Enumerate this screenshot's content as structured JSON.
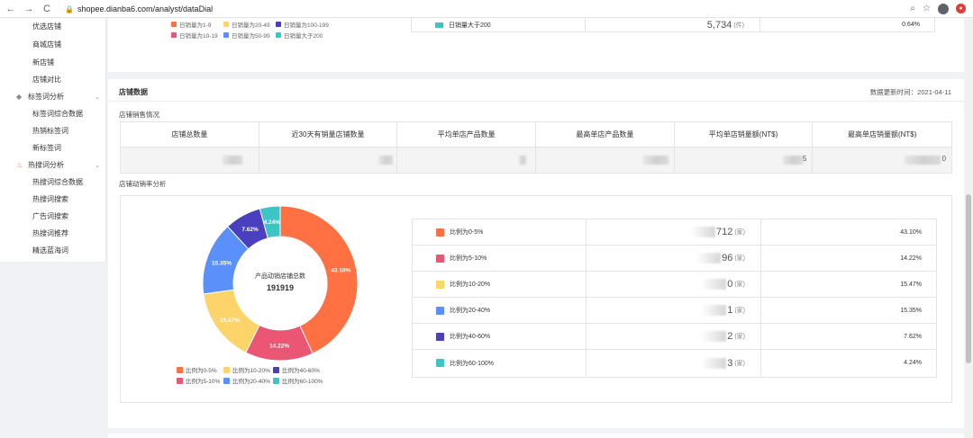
{
  "browser": {
    "url": "shopee.dianba6.com/analyst/dataDial",
    "back_icon": "←",
    "forward_icon": "→",
    "reload_icon": "C"
  },
  "sidebar": {
    "items_top": [
      "优选店铺",
      "商城店铺",
      "新店铺",
      "店铺对比"
    ],
    "group1": "标签词分析",
    "group1_items": [
      "标签词综合数据",
      "热销标签词",
      "新标签词"
    ],
    "group2": "热搜词分析",
    "group2_items": [
      "热搜词综合数据",
      "热搜词搜索",
      "广告词搜索",
      "热搜词推荐",
      "精选蓝海词"
    ]
  },
  "top_card": {
    "legend": [
      {
        "label": "日销量为1-9",
        "color": "#ff7043"
      },
      {
        "label": "日销量为20-49",
        "color": "#fdd46a"
      },
      {
        "label": "日销量为100-199",
        "color": "#4a3fbf"
      },
      {
        "label": "日销量为10-19",
        "color": "#ea5674"
      },
      {
        "label": "日销量为50-99",
        "color": "#5b8ff9"
      },
      {
        "label": "日销量大于200",
        "color": "#3dc4c4"
      }
    ],
    "last_row_label": "日销量大于200",
    "last_row_count": "5,734",
    "last_row_unit": "(件)",
    "last_row_pct": "0.64%"
  },
  "store_data": {
    "title": "店铺数据",
    "update_time": "数据更新时间：2021-04-11",
    "sales_subtitle": "店铺销售情况",
    "columns": [
      "店铺总数量",
      "近30天有销量店铺数量",
      "平均单店产品数量",
      "最高单店产品数量",
      "平均单店销量额(NT$)",
      "最高单店销量额(NT$)"
    ],
    "value_tails": [
      "",
      "",
      "",
      "",
      "5",
      "0"
    ],
    "rate_subtitle": "店铺动销率分析"
  },
  "chart_data": {
    "type": "pie",
    "center_label": "产品动销店铺总数",
    "center_value": "191919",
    "categories": [
      "比例为0-5%",
      "比例为5-10%",
      "比例为10-20%",
      "比例为20-40%",
      "比例为40-60%",
      "比例为60-100%"
    ],
    "values": [
      43.1,
      14.22,
      15.47,
      15.35,
      7.62,
      4.24
    ],
    "slice_labels": [
      "43.10%",
      "14.22%",
      "15.47%",
      "15.35%",
      "7.62%",
      "4.24%"
    ],
    "colors": [
      "#ff7043",
      "#ea5674",
      "#fdd46a",
      "#5b8ff9",
      "#4a3fbf",
      "#3dc4c4"
    ],
    "legend_order": [
      "比例为0-5%",
      "比例为10-20%",
      "比例为40-60%",
      "比例为5-10%",
      "比例为20-40%",
      "比例为60-100%"
    ],
    "legend_colors": [
      "#ff7043",
      "#fdd46a",
      "#4a3fbf",
      "#ea5674",
      "#5b8ff9",
      "#3dc4c4"
    ]
  },
  "distribution_table": [
    {
      "label": "比例为0-5%",
      "count_tail": "712",
      "unit": "(家)",
      "pct": "43.10%",
      "color": "#ff7043"
    },
    {
      "label": "比例为5-10%",
      "count_tail": "96",
      "unit": "(家)",
      "pct": "14.22%",
      "color": "#ea5674"
    },
    {
      "label": "比例为10-20%",
      "count_tail": "0",
      "unit": "(家)",
      "pct": "15.47%",
      "color": "#fdd46a"
    },
    {
      "label": "比例为20-40%",
      "count_tail": "1",
      "unit": "(家)",
      "pct": "15.35%",
      "color": "#5b8ff9"
    },
    {
      "label": "比例为40-60%",
      "count_tail": "2",
      "unit": "(家)",
      "pct": "7.62%",
      "color": "#4a3fbf"
    },
    {
      "label": "比例为60-100%",
      "count_tail": "3",
      "unit": "(家)",
      "pct": "4.24%",
      "color": "#3dc4c4"
    }
  ]
}
